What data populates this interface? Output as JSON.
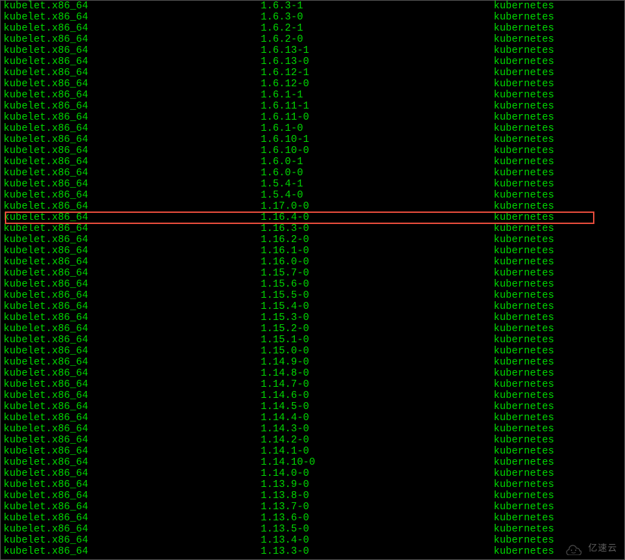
{
  "highlighted_version": "1.16.4-0",
  "rows": [
    {
      "pkg": "kubelet.x86_64",
      "ver": "1.6.3-1",
      "repo": "kubernetes"
    },
    {
      "pkg": "kubelet.x86_64",
      "ver": "1.6.3-0",
      "repo": "kubernetes"
    },
    {
      "pkg": "kubelet.x86_64",
      "ver": "1.6.2-1",
      "repo": "kubernetes"
    },
    {
      "pkg": "kubelet.x86_64",
      "ver": "1.6.2-0",
      "repo": "kubernetes"
    },
    {
      "pkg": "kubelet.x86_64",
      "ver": "1.6.13-1",
      "repo": "kubernetes"
    },
    {
      "pkg": "kubelet.x86_64",
      "ver": "1.6.13-0",
      "repo": "kubernetes"
    },
    {
      "pkg": "kubelet.x86_64",
      "ver": "1.6.12-1",
      "repo": "kubernetes"
    },
    {
      "pkg": "kubelet.x86_64",
      "ver": "1.6.12-0",
      "repo": "kubernetes"
    },
    {
      "pkg": "kubelet.x86_64",
      "ver": "1.6.1-1",
      "repo": "kubernetes"
    },
    {
      "pkg": "kubelet.x86_64",
      "ver": "1.6.11-1",
      "repo": "kubernetes"
    },
    {
      "pkg": "kubelet.x86_64",
      "ver": "1.6.11-0",
      "repo": "kubernetes"
    },
    {
      "pkg": "kubelet.x86_64",
      "ver": "1.6.1-0",
      "repo": "kubernetes"
    },
    {
      "pkg": "kubelet.x86_64",
      "ver": "1.6.10-1",
      "repo": "kubernetes"
    },
    {
      "pkg": "kubelet.x86_64",
      "ver": "1.6.10-0",
      "repo": "kubernetes"
    },
    {
      "pkg": "kubelet.x86_64",
      "ver": "1.6.0-1",
      "repo": "kubernetes"
    },
    {
      "pkg": "kubelet.x86_64",
      "ver": "1.6.0-0",
      "repo": "kubernetes"
    },
    {
      "pkg": "kubelet.x86_64",
      "ver": "1.5.4-1",
      "repo": "kubernetes"
    },
    {
      "pkg": "kubelet.x86_64",
      "ver": "1.5.4-0",
      "repo": "kubernetes"
    },
    {
      "pkg": "kubelet.x86_64",
      "ver": "1.17.0-0",
      "repo": "kubernetes"
    },
    {
      "pkg": "kubelet.x86_64",
      "ver": "1.16.4-0",
      "repo": "kubernetes",
      "highlighted": true
    },
    {
      "pkg": "kubelet.x86_64",
      "ver": "1.16.3-0",
      "repo": "kubernetes"
    },
    {
      "pkg": "kubelet.x86_64",
      "ver": "1.16.2-0",
      "repo": "kubernetes"
    },
    {
      "pkg": "kubelet.x86_64",
      "ver": "1.16.1-0",
      "repo": "kubernetes"
    },
    {
      "pkg": "kubelet.x86_64",
      "ver": "1.16.0-0",
      "repo": "kubernetes"
    },
    {
      "pkg": "kubelet.x86_64",
      "ver": "1.15.7-0",
      "repo": "kubernetes"
    },
    {
      "pkg": "kubelet.x86_64",
      "ver": "1.15.6-0",
      "repo": "kubernetes"
    },
    {
      "pkg": "kubelet.x86_64",
      "ver": "1.15.5-0",
      "repo": "kubernetes"
    },
    {
      "pkg": "kubelet.x86_64",
      "ver": "1.15.4-0",
      "repo": "kubernetes"
    },
    {
      "pkg": "kubelet.x86_64",
      "ver": "1.15.3-0",
      "repo": "kubernetes"
    },
    {
      "pkg": "kubelet.x86_64",
      "ver": "1.15.2-0",
      "repo": "kubernetes"
    },
    {
      "pkg": "kubelet.x86_64",
      "ver": "1.15.1-0",
      "repo": "kubernetes"
    },
    {
      "pkg": "kubelet.x86_64",
      "ver": "1.15.0-0",
      "repo": "kubernetes"
    },
    {
      "pkg": "kubelet.x86_64",
      "ver": "1.14.9-0",
      "repo": "kubernetes"
    },
    {
      "pkg": "kubelet.x86_64",
      "ver": "1.14.8-0",
      "repo": "kubernetes"
    },
    {
      "pkg": "kubelet.x86_64",
      "ver": "1.14.7-0",
      "repo": "kubernetes"
    },
    {
      "pkg": "kubelet.x86_64",
      "ver": "1.14.6-0",
      "repo": "kubernetes"
    },
    {
      "pkg": "kubelet.x86_64",
      "ver": "1.14.5-0",
      "repo": "kubernetes"
    },
    {
      "pkg": "kubelet.x86_64",
      "ver": "1.14.4-0",
      "repo": "kubernetes"
    },
    {
      "pkg": "kubelet.x86_64",
      "ver": "1.14.3-0",
      "repo": "kubernetes"
    },
    {
      "pkg": "kubelet.x86_64",
      "ver": "1.14.2-0",
      "repo": "kubernetes"
    },
    {
      "pkg": "kubelet.x86_64",
      "ver": "1.14.1-0",
      "repo": "kubernetes"
    },
    {
      "pkg": "kubelet.x86_64",
      "ver": "1.14.10-0",
      "repo": "kubernetes"
    },
    {
      "pkg": "kubelet.x86_64",
      "ver": "1.14.0-0",
      "repo": "kubernetes"
    },
    {
      "pkg": "kubelet.x86_64",
      "ver": "1.13.9-0",
      "repo": "kubernetes"
    },
    {
      "pkg": "kubelet.x86_64",
      "ver": "1.13.8-0",
      "repo": "kubernetes"
    },
    {
      "pkg": "kubelet.x86_64",
      "ver": "1.13.7-0",
      "repo": "kubernetes"
    },
    {
      "pkg": "kubelet.x86_64",
      "ver": "1.13.6-0",
      "repo": "kubernetes"
    },
    {
      "pkg": "kubelet.x86_64",
      "ver": "1.13.5-0",
      "repo": "kubernetes"
    },
    {
      "pkg": "kubelet.x86_64",
      "ver": "1.13.4-0",
      "repo": "kubernetes"
    },
    {
      "pkg": "kubelet.x86_64",
      "ver": "1.13.3-0",
      "repo": "kubernetes"
    }
  ],
  "watermark_text": "亿速云"
}
